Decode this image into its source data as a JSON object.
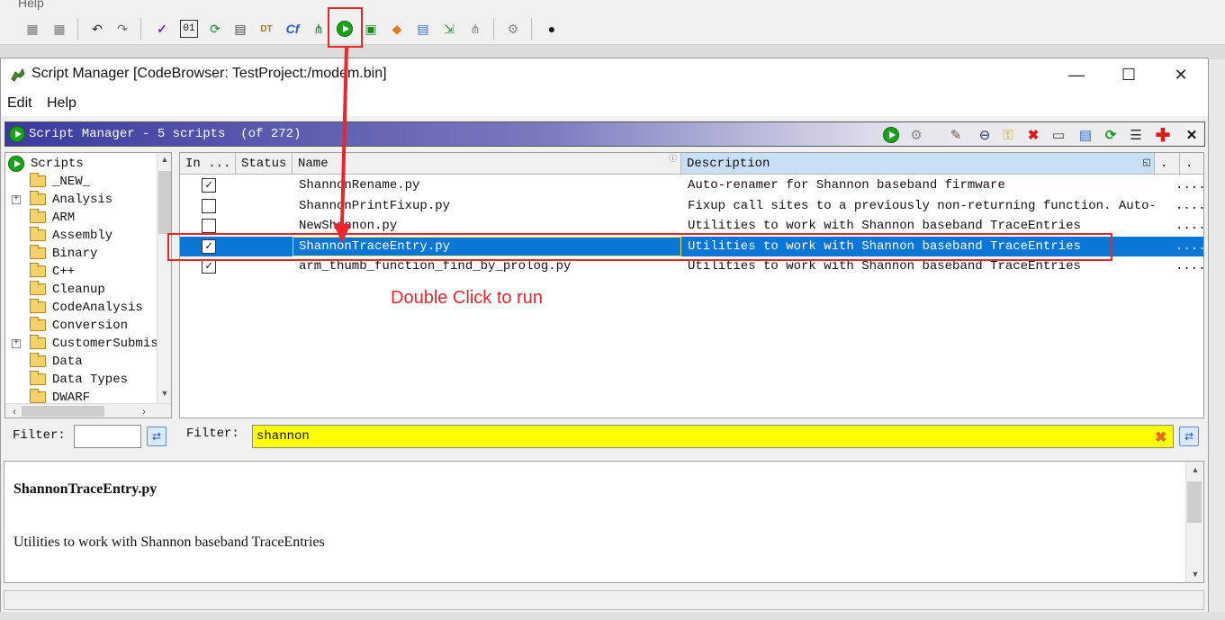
{
  "background_app": {
    "menu": [
      "Help"
    ],
    "toolbar_icons": [
      "module-icon",
      "module-icon",
      "undo-icon",
      "redo-icon",
      "checkmark-icon",
      "bytes-icon",
      "refresh-icon",
      "listing-icon",
      "datatype-icon",
      "function-graph-icon",
      "tree-icon",
      "run-script-icon",
      "memory-icon",
      "diamond-icon",
      "table-icon",
      "export-icon",
      "graph-icon",
      "plugin-icon",
      "bomb-icon"
    ]
  },
  "window": {
    "title": "Script Manager [CodeBrowser: TestProject:/modem.bin]",
    "minimize": "—",
    "maximize": "☐",
    "close": "✕"
  },
  "menu": {
    "edit": "Edit",
    "help": "Help"
  },
  "panel": {
    "title": "Script Manager - 5 scripts  (of 272)",
    "toolbar_icons": [
      "run-script-icon",
      "run-last-icon",
      "edit-script-icon",
      "eclipse-icon",
      "key-icon",
      "delete-icon",
      "rename-icon",
      "new-script-icon",
      "refresh-icon",
      "list-icon",
      "add-icon",
      "close-icon"
    ]
  },
  "tree": {
    "root": "Scripts",
    "items": [
      {
        "label": "_NEW_",
        "expandable": false
      },
      {
        "label": "Analysis",
        "expandable": true
      },
      {
        "label": "ARM",
        "expandable": false
      },
      {
        "label": "Assembly",
        "expandable": false
      },
      {
        "label": "Binary",
        "expandable": false
      },
      {
        "label": "C++",
        "expandable": false
      },
      {
        "label": "Cleanup",
        "expandable": false
      },
      {
        "label": "CodeAnalysis",
        "expandable": false
      },
      {
        "label": "Conversion",
        "expandable": false
      },
      {
        "label": "CustomerSubmis",
        "expandable": true
      },
      {
        "label": "Data",
        "expandable": false
      },
      {
        "label": "Data Types",
        "expandable": false
      },
      {
        "label": "DWARF",
        "expandable": false
      }
    ]
  },
  "table": {
    "columns": {
      "in": "In ...",
      "status": "Status",
      "name": "Name",
      "description": "Description",
      "extra1": ".",
      "extra2": "."
    },
    "rows": [
      {
        "checked": "✓",
        "name": "ShannonRename.py",
        "description": "Auto-renamer for Shannon baseband firmware",
        "more": "....",
        "selected": false
      },
      {
        "checked": "",
        "name": "ShannonPrintFixup.py",
        "description": "Fixup call sites to a previously non-returning function. Auto-ren",
        "more": "....",
        "selected": false
      },
      {
        "checked": "",
        "name": "NewShannon.py",
        "description": "Utilities to work with Shannon baseband TraceEntries",
        "more": "....",
        "selected": false
      },
      {
        "checked": "✓",
        "name": "ShannonTraceEntry.py",
        "description": "Utilities to work with Shannon baseband TraceEntries",
        "more": "....",
        "selected": true
      },
      {
        "checked": "✓",
        "name": "arm_thumb_function_find_by_prolog.py",
        "description": "Utilities to work with Shannon baseband TraceEntries",
        "more": "....",
        "selected": false
      }
    ]
  },
  "annotation": {
    "text": "Double Click to run",
    "color": "#e8262b"
  },
  "filters": {
    "tree_label": "Filter:",
    "tree_value": "",
    "table_label": "Filter:",
    "table_value": "shannon"
  },
  "description_panel": {
    "title": "ShannonTraceEntry.py",
    "text": "Utilities to work with Shannon baseband TraceEntries"
  },
  "colors": {
    "selection": "#0a76d6",
    "filter_highlight": "#ffff00",
    "header_gradient_start": "#3a3a9e"
  }
}
